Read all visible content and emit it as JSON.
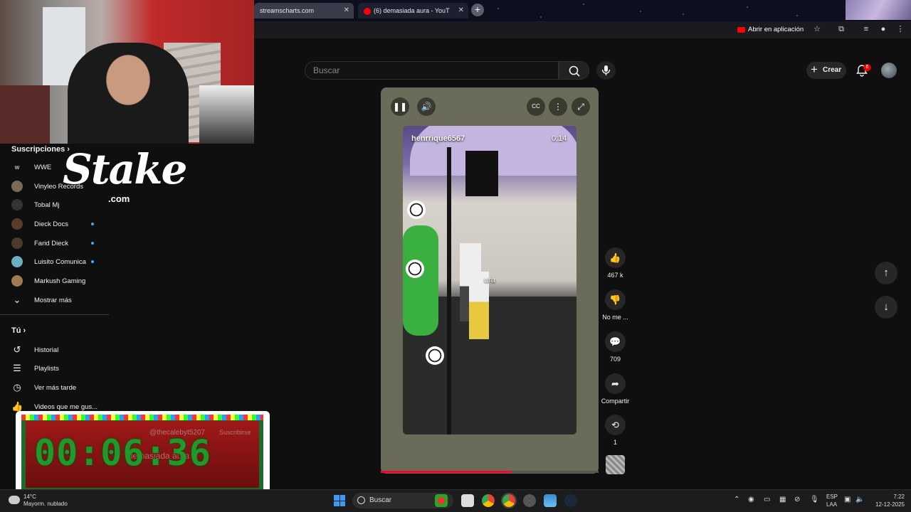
{
  "browser": {
    "tabs": [
      {
        "label": "streamscharts.com"
      },
      {
        "label": "(6) demasiada aura - YouT"
      }
    ],
    "new_tab_symbol": "+",
    "open_in_app": "Abrir en aplicación"
  },
  "youtube": {
    "search_placeholder": "Buscar",
    "create_label": "Crear",
    "notification_count": "6"
  },
  "sidebar": {
    "subscriptions_title": "Suscripciones",
    "subscriptions": [
      {
        "label": "WWE",
        "new": false
      },
      {
        "label": "Vinyleo Records",
        "new": false
      },
      {
        "label": "Tobal Mj",
        "new": false
      },
      {
        "label": "Dieck Docs",
        "new": true
      },
      {
        "label": "Farid Dieck",
        "new": true
      },
      {
        "label": "Luisito Comunica",
        "new": true
      },
      {
        "label": "Markush Gaming",
        "new": false
      }
    ],
    "show_more": "Mostrar más",
    "you_title": "Tú",
    "you_items": [
      {
        "label": "Historial",
        "icon": "history-icon"
      },
      {
        "label": "Playlists",
        "icon": "playlists-icon"
      },
      {
        "label": "Ver más tarde",
        "icon": "clock-icon"
      },
      {
        "label": "Videos que me gus...",
        "icon": "thumbs-up-icon"
      }
    ]
  },
  "sponsor": {
    "logo_text": "Stake",
    "logo_suffix": ".com"
  },
  "short": {
    "channel": "henrrique6567",
    "time": "0:14",
    "overlay_text": "ura",
    "progress_fraction": 0.6,
    "likes": "467 k",
    "dislike_label": "No me ...",
    "comments": "709",
    "share_label": "Compartir",
    "remix_count": "1"
  },
  "timer_overlay": {
    "time": "00:06:36",
    "chat_user": "@thecalebyt5207",
    "chat_badge": "Suscribirse",
    "chat_message": "demasiada aura"
  },
  "taskbar": {
    "weather_temp": "14°C",
    "weather_desc": "Mayorm. nublado",
    "search_label": "Buscar",
    "lang_line1": "ESP",
    "lang_line2": "LAA",
    "time": "7:22",
    "date": "12-12-2025"
  },
  "colors": {
    "youtube_red": "#ff0000",
    "progress_red": "#ff0033",
    "timer_green": "#1e9a2a",
    "accent_blue": "#3ea6ff"
  }
}
